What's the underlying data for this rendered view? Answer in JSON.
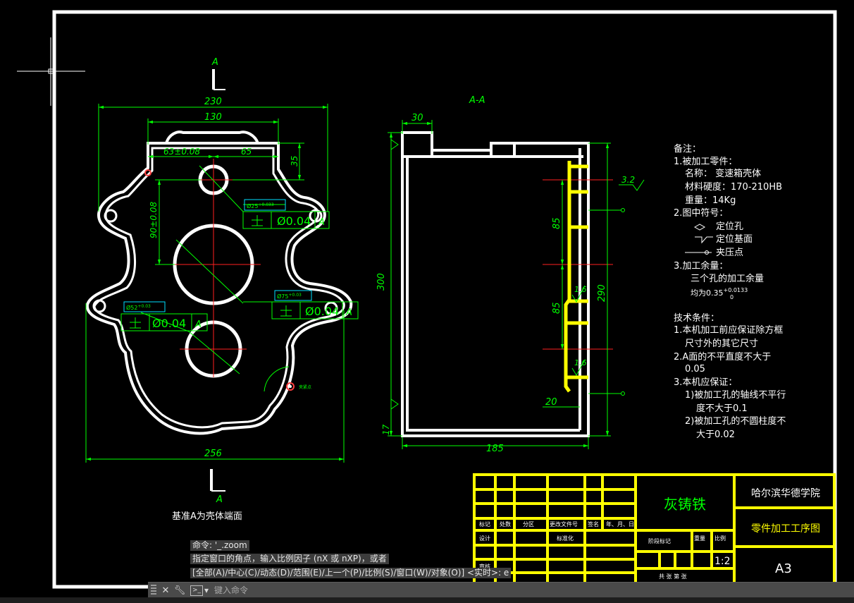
{
  "section_label_a": "A",
  "section_title": "A-A",
  "front_view_dims": {
    "width_total": "230",
    "width_top": "130",
    "offset_left": "63±0.08",
    "offset_right": "65",
    "height_top": "35",
    "vertical_offset": "90±0.08",
    "width_bottom": "256"
  },
  "front_view_tolerances": {
    "small_hole_dia": "Ø25",
    "small_hole_tol": "+0.033",
    "fcf_small": "Ø0.04",
    "fcf_small_datum": "A",
    "mid_hole_dia": "Ø75",
    "mid_hole_tol": "+0.03",
    "fcf_mid": "Ø0.04",
    "fcf_mid_datum": "A",
    "large_hole_dia": "Ø52",
    "large_hole_tol": "+0.03",
    "fcf_large": "Ø0.04",
    "fcf_large_datum": "A",
    "clamp_note": "夹紧点"
  },
  "section_view_dims": {
    "top_width": "30",
    "height_total": "300",
    "height_right": "290",
    "upper_span": "85",
    "lower_span": "85",
    "bottom_step": "20",
    "bottom_thickness": "17",
    "width": "185",
    "roughness_top": "3.2",
    "roughness_mid": "1.6",
    "roughness_low": "1.6"
  },
  "datum_note": "基准A为壳体端面",
  "notes": {
    "title": "备注：",
    "item1": "1.被加工零件：",
    "name": "名称： 变速箱壳体",
    "hardness": "材料硬度：170-210HB",
    "weight": "重量：14Kg",
    "item2": "2.图中符号：",
    "sym1": "定位孔",
    "sym2": "定位基面",
    "sym3": "夹压点",
    "item3": "3.加工余量：",
    "allowance": "三个孔的加工余量",
    "allowance_value": "均为0.35",
    "allowance_upper": "+0.0133",
    "allowance_lower": "0"
  },
  "tech": {
    "title": "技术条件：",
    "line1": "1.本机加工前应保证除方框",
    "line1b": "尺寸外的其它尺寸",
    "line2": "2.A面的不平直度不大于",
    "line2b": "0.05",
    "line3": "3.本机应保证：",
    "line3a": "1)被加工孔的轴线不平行",
    "line3a2": "度不大于0.1",
    "line3b": "2)被加工孔的不圆柱度不",
    "line3b2": "大于0.02"
  },
  "title_block": {
    "material": "灰铸铁",
    "school": "哈尔滨华德学院",
    "drawing_name": "零件加工工序图",
    "size": "A3",
    "scale": "1:2",
    "h_mark": "标记",
    "h_count": "处数",
    "h_zone": "分区",
    "h_doc": "更改文件号",
    "h_sign": "签名",
    "h_date": "年、月、日",
    "h_design": "设计",
    "h_std": "标准化",
    "h_stage": "阶段标记",
    "h_weight": "重量",
    "h_ratio": "比例",
    "h_audit": "审核",
    "h_sheets": "共  张  第  张"
  },
  "command": {
    "history1": "命令: '_.zoom",
    "history2": "指定窗口的角点，输入比例因子 (nX 或 nXP)，或者",
    "history3": "[全部(A)/中心(C)/动态(D)/范围(E)/上一个(P)/比例(S)/窗口(W)/对象(O)] <实时>: e",
    "placeholder": "键入命令"
  },
  "colors": {
    "background": "#000000",
    "geometry": "#ffffff",
    "dimension": "#00ff00",
    "center_line": "#ff0000",
    "title_block": "#ffff00",
    "tolerance_box": "#00e0ff"
  }
}
